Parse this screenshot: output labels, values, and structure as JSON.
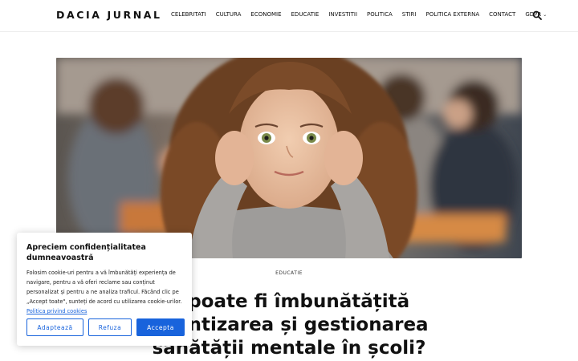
{
  "header": {
    "logo": "DACIA JURNAL",
    "nav": [
      {
        "label": "CELEBRITATI"
      },
      {
        "label": "CULTURA"
      },
      {
        "label": "ECONOMIE"
      },
      {
        "label": "EDUCATIE"
      },
      {
        "label": "INVESTITII"
      },
      {
        "label": "POLITICA"
      },
      {
        "label": "STIRI"
      },
      {
        "label": "POLITICA EXTERNA"
      },
      {
        "label": "CONTACT"
      },
      {
        "label": "GDPR"
      }
    ],
    "search_icon": "search-icon",
    "dropdown_icon": "chevron-down-icon"
  },
  "article": {
    "category": "EDUCATIE",
    "title_line1": "n poate fi îmbunătățită",
    "title_line2": "știentizarea și gestionarea",
    "title_line3": "sănătății mentale în școli?"
  },
  "cookie": {
    "title": "Apreciem confidențialitatea dumneavoastră",
    "text": "Folosim cookie-uri pentru a vă îmbunătăți experiența de navigare, pentru a vă oferi reclame sau conținut personalizat și pentru a ne analiza traficul. Făcând clic pe „Accept toate\", sunteți de acord cu utilizarea cookie-urilor.",
    "link": "Politica privind cookies",
    "buttons": {
      "customize": "Adaptează",
      "reject": "Refuza",
      "accept": "Accepta"
    }
  },
  "colors": {
    "accent": "#1863dc",
    "text": "#111111"
  }
}
